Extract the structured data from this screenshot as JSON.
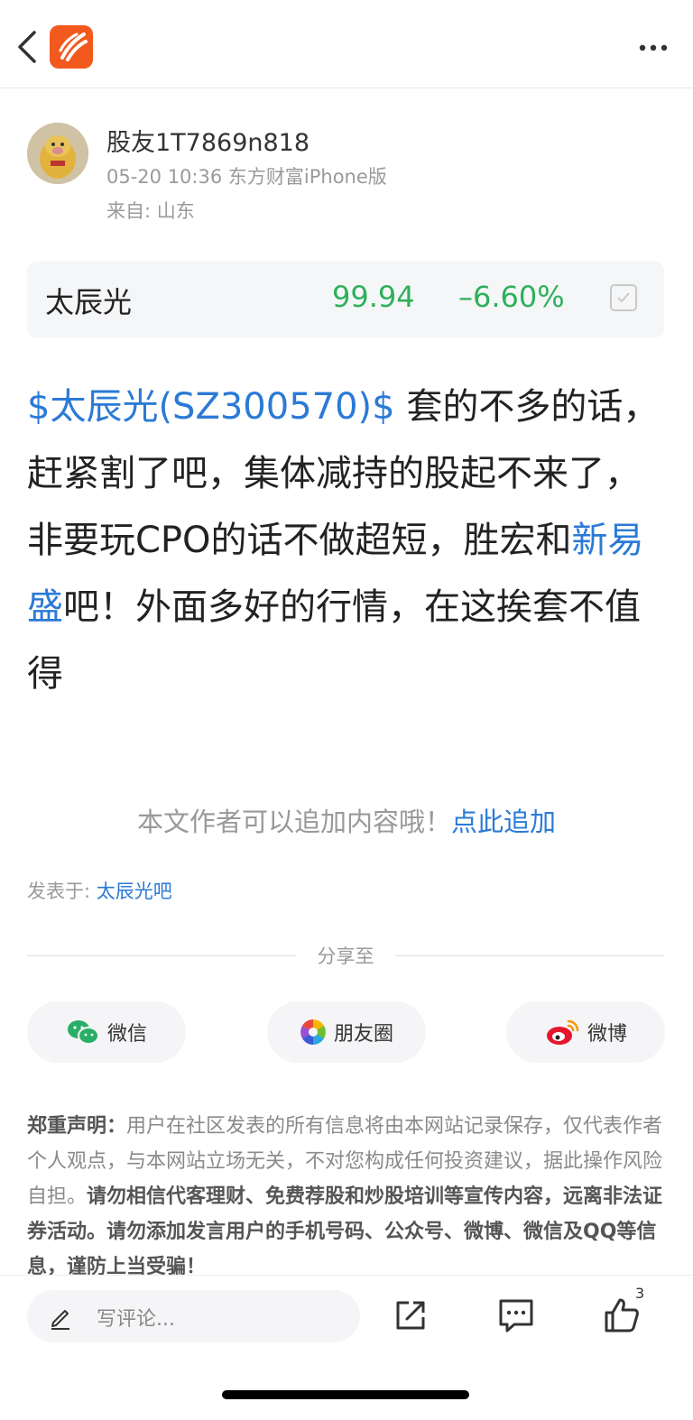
{
  "header": {
    "back_icon": "chevron-left-icon",
    "logo_icon": "eastmoney-logo-icon",
    "more_icon": "more-dots-icon"
  },
  "author": {
    "name": "股友1T7869n818",
    "meta": "05-20 10:36 东方财富iPhone版",
    "location": "来自: 山东"
  },
  "stock": {
    "name": "太辰光",
    "price": "99.94",
    "change": "–6.60%",
    "color_down": "#2db15a"
  },
  "post": {
    "ticker_link": "$太辰光(SZ300570)$",
    "text_1": "  套的不多的话，赶紧割了吧，集体减持的股起不来了，非要玩CPO的话不做超短，胜宏和",
    "stock_link": "新易盛",
    "text_2": "吧！外面多好的行情，在这挨套不值得"
  },
  "append": {
    "text": "本文作者可以追加内容哦！",
    "link": "点此追加"
  },
  "posted_in": {
    "label": "发表于: ",
    "link": "太辰光吧"
  },
  "share": {
    "title": "分享至",
    "buttons": [
      {
        "label": "微信",
        "icon": "wechat-icon"
      },
      {
        "label": "朋友圈",
        "icon": "moments-icon"
      },
      {
        "label": "微博",
        "icon": "weibo-icon"
      }
    ]
  },
  "disclaimer": {
    "title": "郑重声明：",
    "text": "用户在社区发表的所有信息将由本网站记录保存，仅代表作者个人观点，与本网站立场无关，不对您构成任何投资建议，据此操作风险自担。",
    "bold": "请勿相信代客理财、免费荐股和炒股培训等宣传内容，远离非法证券活动。请勿添加发言用户的手机号码、公众号、微博、微信及QQ等信息，谨防上当受骗！"
  },
  "bottom": {
    "comment_placeholder": "写评论...",
    "like_count": "3"
  },
  "colors": {
    "link": "#2b7ad6",
    "brand": "#f25a1d"
  }
}
